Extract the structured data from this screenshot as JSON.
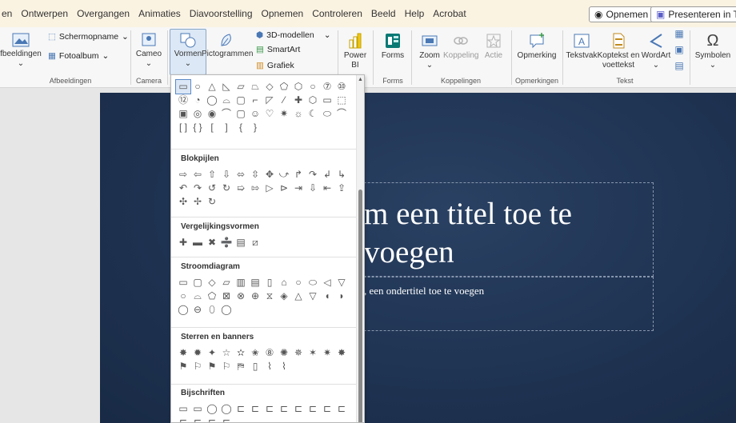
{
  "menubar": {
    "items": [
      "en",
      "Ontwerpen",
      "Overgangen",
      "Animaties",
      "Diavoorstelling",
      "Opnemen",
      "Controleren",
      "Beeld",
      "Help",
      "Acrobat"
    ],
    "record_label": "Opnemen",
    "present_label": "Presenteren in Tear"
  },
  "ribbon": {
    "afbeeldingen": "fbeeldingen",
    "schermopname": "Schermopname",
    "fotoalbum": "Fotoalbum",
    "cameo": "Cameo",
    "vormen": "Vormen",
    "pictogrammen": "Pictogrammen",
    "modellen3d": "3D-modellen",
    "smartart": "SmartArt",
    "grafiek": "Grafiek",
    "powerbi_1": "Power",
    "powerbi_2": "BI",
    "forms": "Forms",
    "zoom": "Zoom",
    "koppeling": "Koppeling",
    "actie": "Actie",
    "opmerking": "Opmerking",
    "tekstvak": "Tekstvak",
    "koptekst_1": "Koptekst en",
    "koptekst_2": "voettekst",
    "wordart": "WordArt",
    "symbolen": "Symbolen",
    "groups": {
      "afbeeldingen": "Afbeeldingen",
      "camera": "Camera",
      "forms": "Forms",
      "koppelingen": "Koppelingen",
      "opmerkingen": "Opmerkingen",
      "tekst": "Tekst"
    }
  },
  "slide": {
    "title_line1": "m een titel toe te",
    "title_line2": "voegen",
    "subtitle": ", een ondertitel toe te voegen"
  },
  "shapes_menu": {
    "categories": {
      "blokpijlen": "Blokpijlen",
      "vergelijkingsvormen": "Vergelijkingsvormen",
      "stroomdiagram": "Stroomdiagram",
      "sterren": "Sterren en banners",
      "bijschriften": "Bijschriften"
    },
    "basic_rows": [
      [
        "▭",
        "○",
        "△",
        "◺",
        "▱",
        "⏢",
        "◇",
        "⬠",
        "⬡",
        "○",
        "⑦",
        "⑩"
      ],
      [
        "⑫",
        "◔",
        "◯",
        "⌓",
        "▢",
        "⌐",
        "◸",
        "⁄",
        "✚",
        "⬡",
        "▭",
        "⬚"
      ],
      [
        "▣",
        "◎",
        "◉",
        "⌒",
        "▢",
        "☺",
        "♡",
        "✷",
        "☼",
        "☾",
        "⬭",
        "⌒"
      ],
      [
        "[ ]",
        "{ }",
        "[",
        "]",
        "{",
        "}"
      ]
    ],
    "blok_rows": [
      [
        "⇨",
        "⇦",
        "⇧",
        "⇩",
        "⬄",
        "⇳",
        "✥",
        "⤻",
        "↱",
        "↷",
        "↲",
        "↳"
      ],
      [
        "↶",
        "↷",
        "↺",
        "↻",
        "➯",
        "⇰",
        "▷",
        "⊳",
        "⇥",
        "⇩",
        "⇤",
        "⇪"
      ],
      [
        "✣",
        "✢",
        "↻"
      ]
    ],
    "verg_rows": [
      [
        "✚",
        "▬",
        "✖",
        "➗",
        "▤",
        "⧄"
      ]
    ],
    "stroom_rows": [
      [
        "▭",
        "▢",
        "◇",
        "▱",
        "▥",
        "▤",
        "▯",
        "⌂",
        "○",
        "⬭",
        "◁",
        "▽"
      ],
      [
        "○",
        "⌓",
        "⬠",
        "⊠",
        "⊗",
        "⊕",
        "⧖",
        "◈",
        "△",
        "▽",
        "◖",
        "◗"
      ],
      [
        "◯",
        "⊖",
        "⬯",
        "◯"
      ]
    ],
    "ster_rows": [
      [
        "✸",
        "✹",
        "✦",
        "☆",
        "✫",
        "✬",
        "⑧",
        "✺",
        "✵",
        "✶",
        "✷",
        "✸"
      ],
      [
        "⚑",
        "⚐",
        "⚑",
        "⚐",
        "⛿",
        "▯",
        "⌇",
        "⌇"
      ]
    ],
    "bijschrift_rows": [
      [
        "▭",
        "▭",
        "◯",
        "◯",
        "⊏",
        "⊏",
        "⊏",
        "⊏",
        "⊏",
        "⊏",
        "⊏",
        "⊏"
      ],
      [
        "⊏",
        "⊏",
        "⊏",
        "⊏"
      ]
    ]
  }
}
